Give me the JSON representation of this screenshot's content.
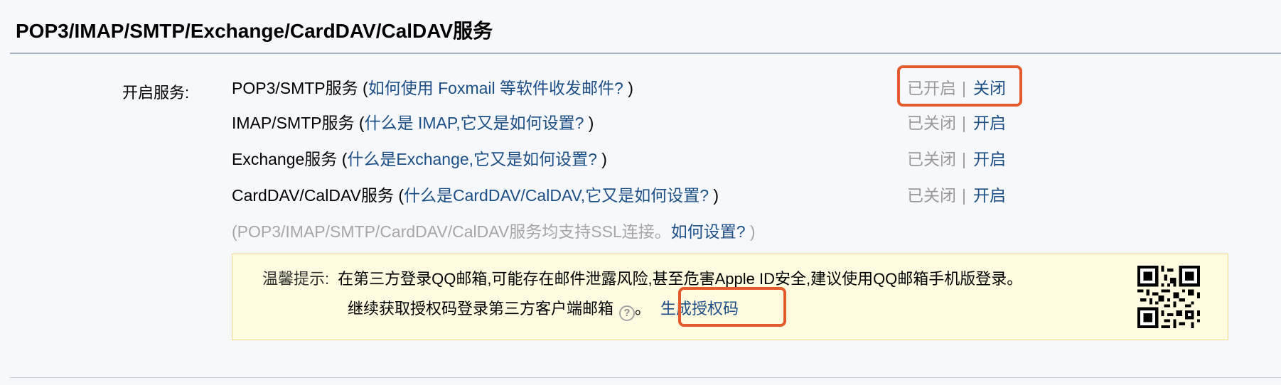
{
  "section": {
    "title": "POP3/IMAP/SMTP/Exchange/CardDAV/CalDAV服务"
  },
  "services_label": "开启服务:",
  "services": [
    {
      "name": "POP3/SMTP服务",
      "open_paren": " (",
      "help": "如何使用 Foxmail 等软件收发邮件?",
      "close_paren": " )",
      "state": "已开启",
      "sep": "|",
      "action": "关闭"
    },
    {
      "name": "IMAP/SMTP服务",
      "open_paren": " (",
      "help": "什么是 IMAP,它又是如何设置?",
      "close_paren": " )",
      "state": "已关闭",
      "sep": "|",
      "action": "开启"
    },
    {
      "name": "Exchange服务",
      "open_paren": " (",
      "help": "什么是Exchange,它又是如何设置?",
      "close_paren": " )",
      "state": "已关闭",
      "sep": "|",
      "action": "开启"
    },
    {
      "name": "CardDAV/CalDAV服务",
      "open_paren": " (",
      "help": "什么是CardDAV/CalDAV,它又是如何设置?",
      "close_paren": " )",
      "state": "已关闭",
      "sep": "|",
      "action": "开启"
    }
  ],
  "ssl_note": {
    "text": "(POP3/IMAP/SMTP/CardDAV/CalDAV服务均支持SSL连接。",
    "link": "如何设置?",
    "close": " )"
  },
  "tip": {
    "prefix": "温馨提示:",
    "message": "在第三方登录QQ邮箱,可能存在邮件泄露风险,甚至危害Apple ID安全,建议使用QQ邮箱手机版登录。",
    "line2": "继续获取授权码登录第三方客户端邮箱",
    "help_icon": "?",
    "period": "。",
    "generate_link": "生成授权码"
  },
  "colors": {
    "link": "#1d4f87",
    "muted": "#999999",
    "highlight": "#e35b2c",
    "tip_bg": "#fffbe0"
  }
}
